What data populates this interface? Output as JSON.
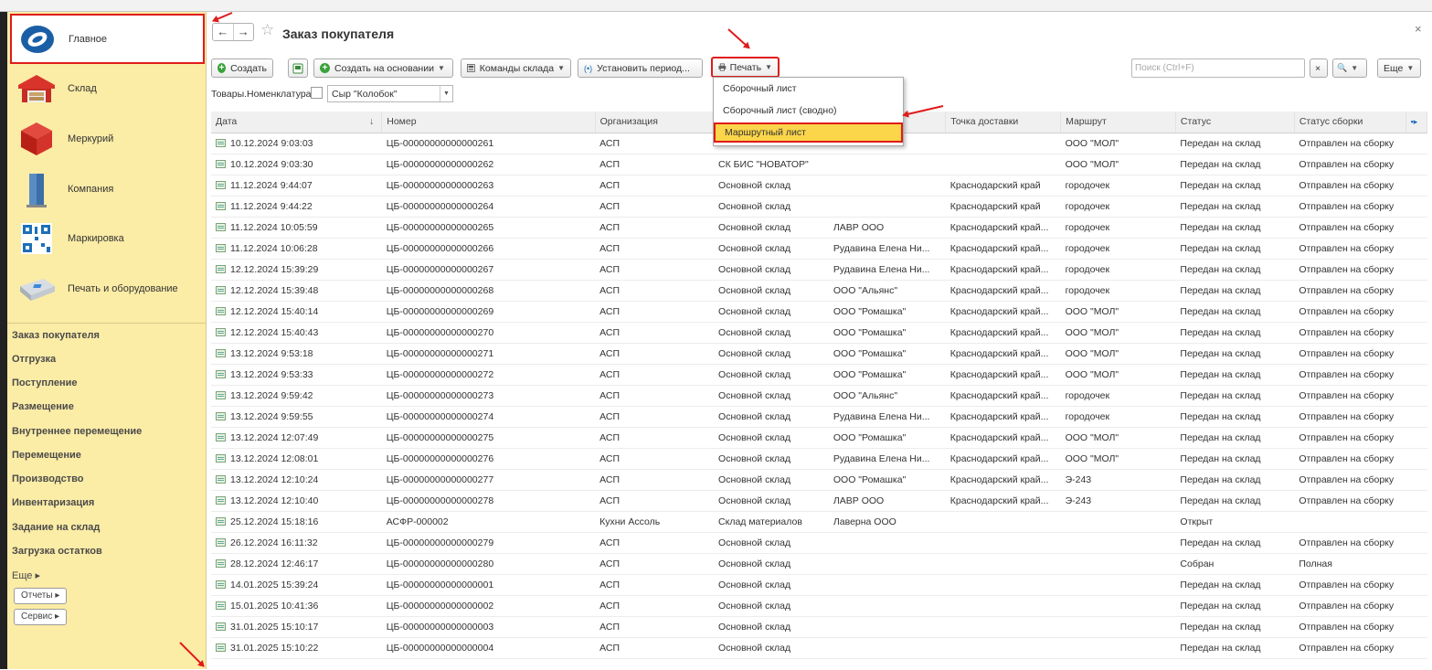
{
  "sidebar": {
    "sections": [
      {
        "label": "Главное",
        "icon": "main-logo-icon"
      },
      {
        "label": "Склад",
        "icon": "warehouse-icon"
      },
      {
        "label": "Меркурий",
        "icon": "mercury-cube-icon"
      },
      {
        "label": "Компания",
        "icon": "building-icon"
      },
      {
        "label": "Маркировка",
        "icon": "qr-code-icon"
      },
      {
        "label": "Печать и оборудование",
        "icon": "printer-icon"
      }
    ],
    "links": [
      "Заказ покупателя",
      "Отгрузка",
      "Поступление",
      "Размещение",
      "Внутреннее перемещение",
      "Перемещение",
      "Производство",
      "Инвентаризация",
      "Задание на склад",
      "Загрузка остатков"
    ],
    "more": "Еще ▸",
    "reports": "Отчеты ▸",
    "service": "Сервис ▸"
  },
  "header": {
    "title": "Заказ покупателя",
    "star": "☆",
    "back": "←",
    "forward": "→",
    "close": "×"
  },
  "toolbar": {
    "create": "Создать",
    "create_based": "Создать на основании",
    "warehouse_cmds": "Команды склада",
    "set_period": "Установить период...",
    "print": "Печать",
    "search_placeholder": "Поиск (Ctrl+F)",
    "search_clear": "×",
    "search_btn": "🔍",
    "more": "Еще"
  },
  "filter": {
    "label": "Товары.Номенклатура:",
    "value": "Сыр \"Колобок\""
  },
  "print_menu": [
    "Сборочный лист",
    "Сборочный лист (сводно)",
    "Маршрутный лист"
  ],
  "columns": [
    "Дата",
    "Номер",
    "Организация",
    "",
    "",
    "Точка доставки",
    "Маршрут",
    "Статус",
    "Статус сборки"
  ],
  "sort_indicator": "↓",
  "rows": [
    [
      "10.12.2024 9:03:03",
      "ЦБ-00000000000000261",
      "АСП",
      "",
      "",
      "",
      "ООО \"МОЛ\"",
      "Передан на склад",
      "Отправлен на сборку"
    ],
    [
      "10.12.2024 9:03:30",
      "ЦБ-00000000000000262",
      "АСП",
      "СК БИС \"НОВАТОР\"",
      "",
      "",
      "ООО \"МОЛ\"",
      "Передан на склад",
      "Отправлен на сборку"
    ],
    [
      "11.12.2024 9:44:07",
      "ЦБ-00000000000000263",
      "АСП",
      "Основной склад",
      "",
      "Краснодарский край",
      "городочек",
      "Передан на склад",
      "Отправлен на сборку"
    ],
    [
      "11.12.2024 9:44:22",
      "ЦБ-00000000000000264",
      "АСП",
      "Основной склад",
      "",
      "Краснодарский край",
      "городочек",
      "Передан на склад",
      "Отправлен на сборку"
    ],
    [
      "11.12.2024 10:05:59",
      "ЦБ-00000000000000265",
      "АСП",
      "Основной склад",
      "ЛАВР ООО",
      "Краснодарский край...",
      "городочек",
      "Передан на склад",
      "Отправлен на сборку"
    ],
    [
      "11.12.2024 10:06:28",
      "ЦБ-00000000000000266",
      "АСП",
      "Основной склад",
      "Рудавина Елена Ни...",
      "Краснодарский край...",
      "городочек",
      "Передан на склад",
      "Отправлен на сборку"
    ],
    [
      "12.12.2024 15:39:29",
      "ЦБ-00000000000000267",
      "АСП",
      "Основной склад",
      "Рудавина Елена Ни...",
      "Краснодарский край...",
      "городочек",
      "Передан на склад",
      "Отправлен на сборку"
    ],
    [
      "12.12.2024 15:39:48",
      "ЦБ-00000000000000268",
      "АСП",
      "Основной склад",
      "ООО \"Альянс\"",
      "Краснодарский край...",
      "городочек",
      "Передан на склад",
      "Отправлен на сборку"
    ],
    [
      "12.12.2024 15:40:14",
      "ЦБ-00000000000000269",
      "АСП",
      "Основной склад",
      "ООО \"Ромашка\"",
      "Краснодарский край...",
      "ООО \"МОЛ\"",
      "Передан на склад",
      "Отправлен на сборку"
    ],
    [
      "12.12.2024 15:40:43",
      "ЦБ-00000000000000270",
      "АСП",
      "Основной склад",
      "ООО \"Ромашка\"",
      "Краснодарский край...",
      "ООО \"МОЛ\"",
      "Передан на склад",
      "Отправлен на сборку"
    ],
    [
      "13.12.2024 9:53:18",
      "ЦБ-00000000000000271",
      "АСП",
      "Основной склад",
      "ООО \"Ромашка\"",
      "Краснодарский край...",
      "ООО \"МОЛ\"",
      "Передан на склад",
      "Отправлен на сборку"
    ],
    [
      "13.12.2024 9:53:33",
      "ЦБ-00000000000000272",
      "АСП",
      "Основной склад",
      "ООО \"Ромашка\"",
      "Краснодарский край...",
      "ООО \"МОЛ\"",
      "Передан на склад",
      "Отправлен на сборку"
    ],
    [
      "13.12.2024 9:59:42",
      "ЦБ-00000000000000273",
      "АСП",
      "Основной склад",
      "ООО \"Альянс\"",
      "Краснодарский край...",
      "городочек",
      "Передан на склад",
      "Отправлен на сборку"
    ],
    [
      "13.12.2024 9:59:55",
      "ЦБ-00000000000000274",
      "АСП",
      "Основной склад",
      "Рудавина Елена Ни...",
      "Краснодарский край...",
      "городочек",
      "Передан на склад",
      "Отправлен на сборку"
    ],
    [
      "13.12.2024 12:07:49",
      "ЦБ-00000000000000275",
      "АСП",
      "Основной склад",
      "ООО \"Ромашка\"",
      "Краснодарский край...",
      "ООО \"МОЛ\"",
      "Передан на склад",
      "Отправлен на сборку"
    ],
    [
      "13.12.2024 12:08:01",
      "ЦБ-00000000000000276",
      "АСП",
      "Основной склад",
      "Рудавина Елена Ни...",
      "Краснодарский край...",
      "ООО \"МОЛ\"",
      "Передан на склад",
      "Отправлен на сборку"
    ],
    [
      "13.12.2024 12:10:24",
      "ЦБ-00000000000000277",
      "АСП",
      "Основной склад",
      "ООО \"Ромашка\"",
      "Краснодарский край...",
      "Э-243",
      "Передан на склад",
      "Отправлен на сборку"
    ],
    [
      "13.12.2024 12:10:40",
      "ЦБ-00000000000000278",
      "АСП",
      "Основной склад",
      "ЛАВР ООО",
      "Краснодарский край...",
      "Э-243",
      "Передан на склад",
      "Отправлен на сборку"
    ],
    [
      "25.12.2024 15:18:16",
      "АСФР-000002",
      "Кухни Ассоль",
      "Склад материалов",
      "Лаверна ООО",
      "",
      "",
      "Открыт",
      ""
    ],
    [
      "26.12.2024 16:11:32",
      "ЦБ-00000000000000279",
      "АСП",
      "Основной склад",
      "",
      "",
      "",
      "Передан на склад",
      "Отправлен на сборку"
    ],
    [
      "28.12.2024 12:46:17",
      "ЦБ-00000000000000280",
      "АСП",
      "Основной склад",
      "",
      "",
      "",
      "Собран",
      "Полная"
    ],
    [
      "14.01.2025 15:39:24",
      "ЦБ-00000000000000001",
      "АСП",
      "Основной склад",
      "",
      "",
      "",
      "Передан на склад",
      "Отправлен на сборку"
    ],
    [
      "15.01.2025 10:41:36",
      "ЦБ-00000000000000002",
      "АСП",
      "Основной склад",
      "",
      "",
      "",
      "Передан на склад",
      "Отправлен на сборку"
    ],
    [
      "31.01.2025 15:10:17",
      "ЦБ-00000000000000003",
      "АСП",
      "Основной склад",
      "",
      "",
      "",
      "Передан на склад",
      "Отправлен на сборку"
    ],
    [
      "31.01.2025 15:10:22",
      "ЦБ-00000000000000004",
      "АСП",
      "Основной склад",
      "",
      "",
      "",
      "Передан на склад",
      "Отправлен на сборку"
    ]
  ],
  "colors": {
    "sidebar_bg": "#fbeca6",
    "highlight": "#fbd54a",
    "annotation_red": "#e01b1b"
  }
}
